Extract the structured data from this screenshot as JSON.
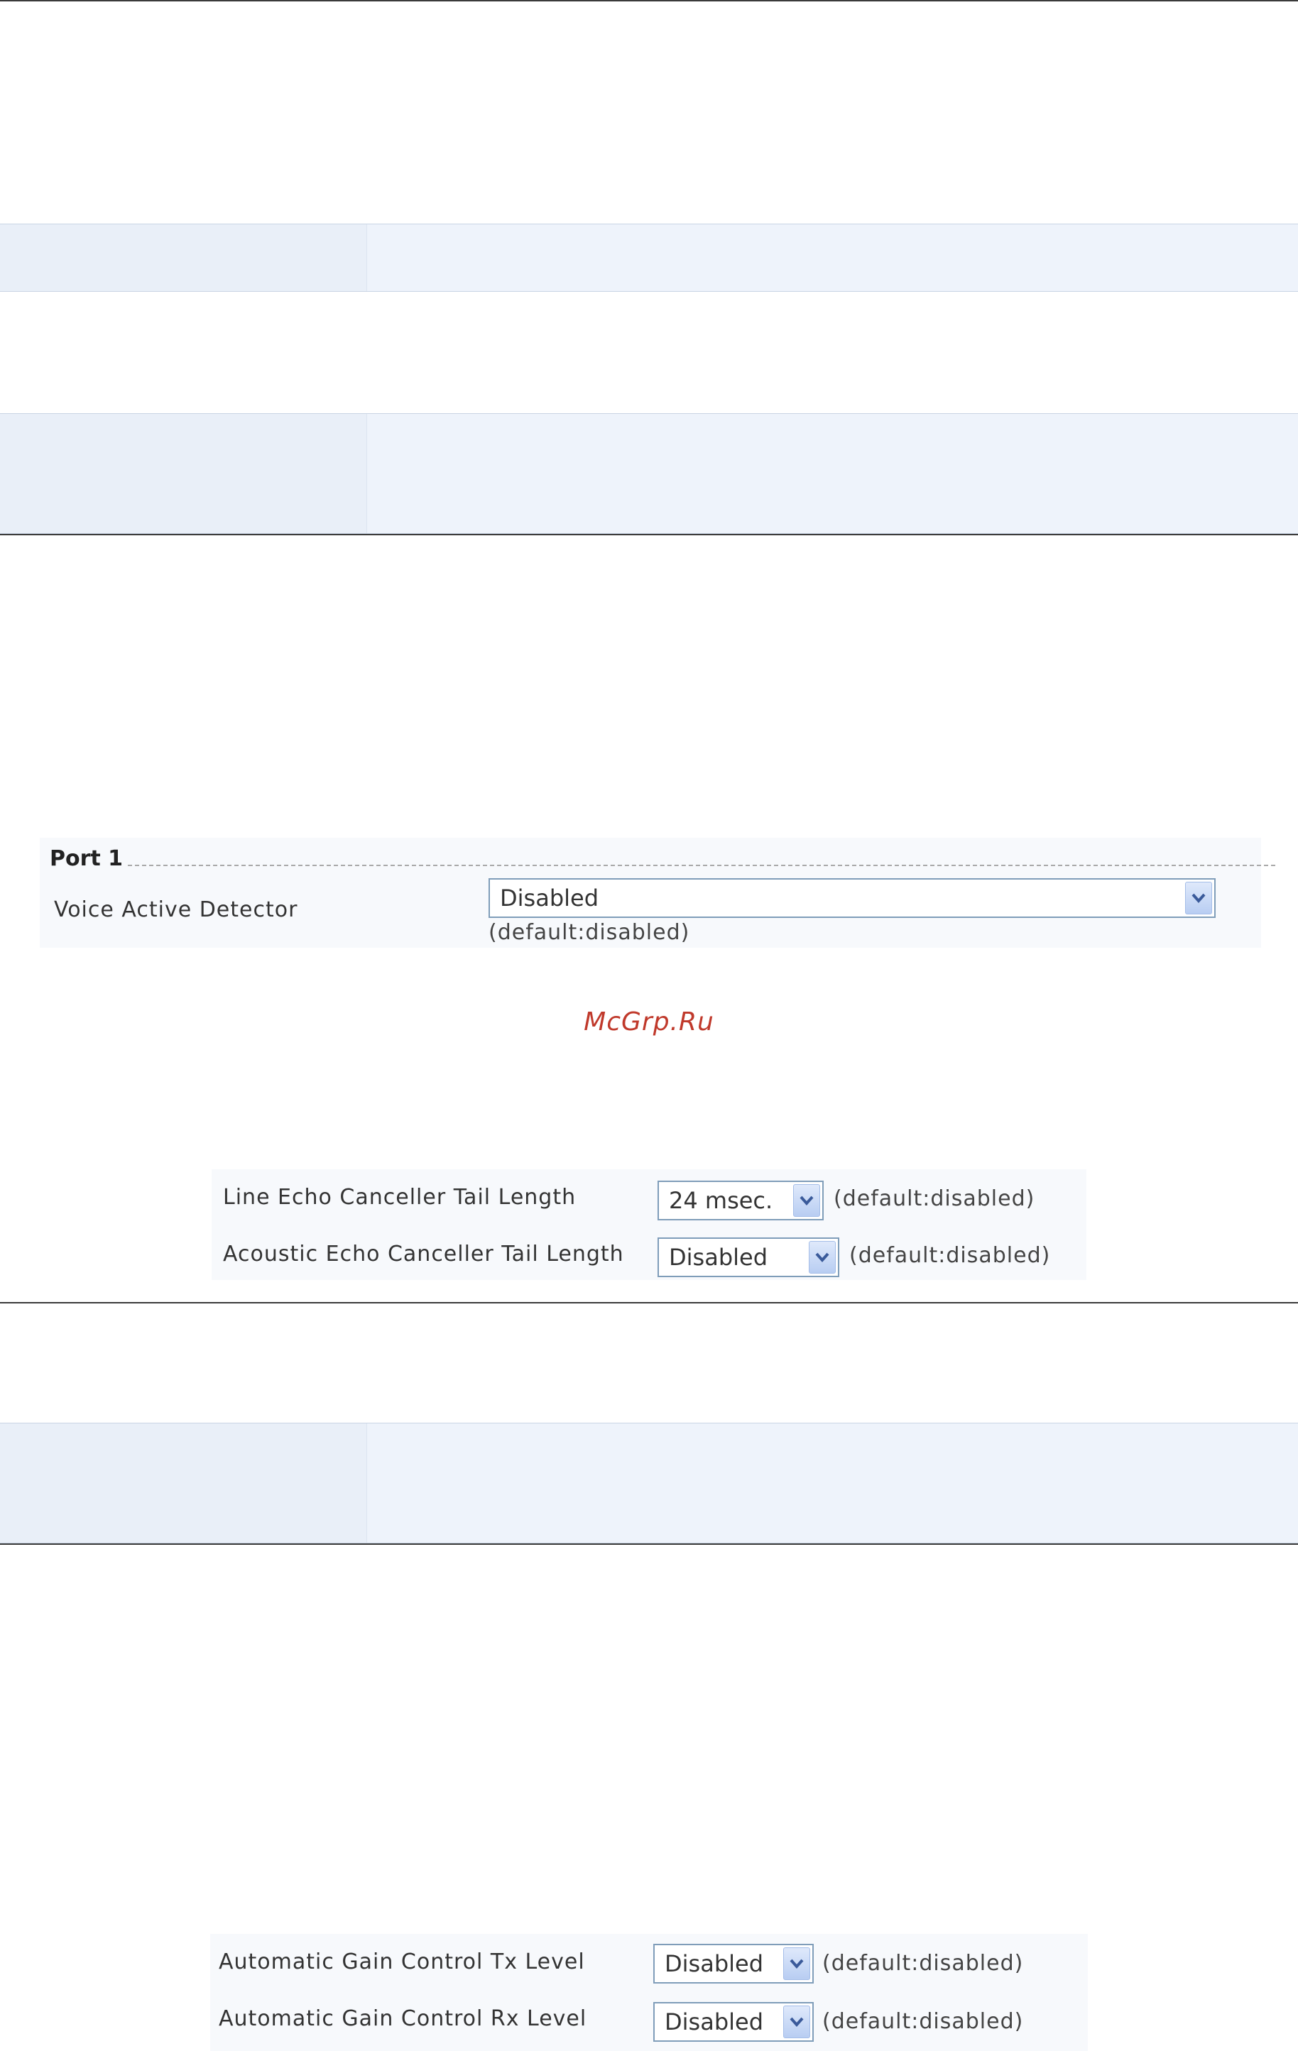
{
  "vad": {
    "section_title": "Port 1",
    "label": "Voice Active Detector",
    "value": "Disabled",
    "hint": "(default:disabled)"
  },
  "watermark": "McGrp.Ru",
  "echo": {
    "line": {
      "label": "Line Echo Canceller Tail Length",
      "value": "24 msec.",
      "hint": "(default:disabled)"
    },
    "acoustic": {
      "label": "Acoustic Echo Canceller Tail Length",
      "value": "Disabled",
      "hint": "(default:disabled)"
    }
  },
  "agc": {
    "tx": {
      "label": "Automatic Gain Control Tx Level",
      "value": "Disabled",
      "hint": "(default:disabled)"
    },
    "rx": {
      "label": "Automatic Gain Control Rx Level",
      "value": "Disabled",
      "hint": "(default:disabled)"
    }
  },
  "colors": {
    "band": "#eef3fb",
    "select_border": "#7f9db9",
    "watermark": "#c0392b"
  },
  "icons": [
    "chevron-down-icon"
  ]
}
